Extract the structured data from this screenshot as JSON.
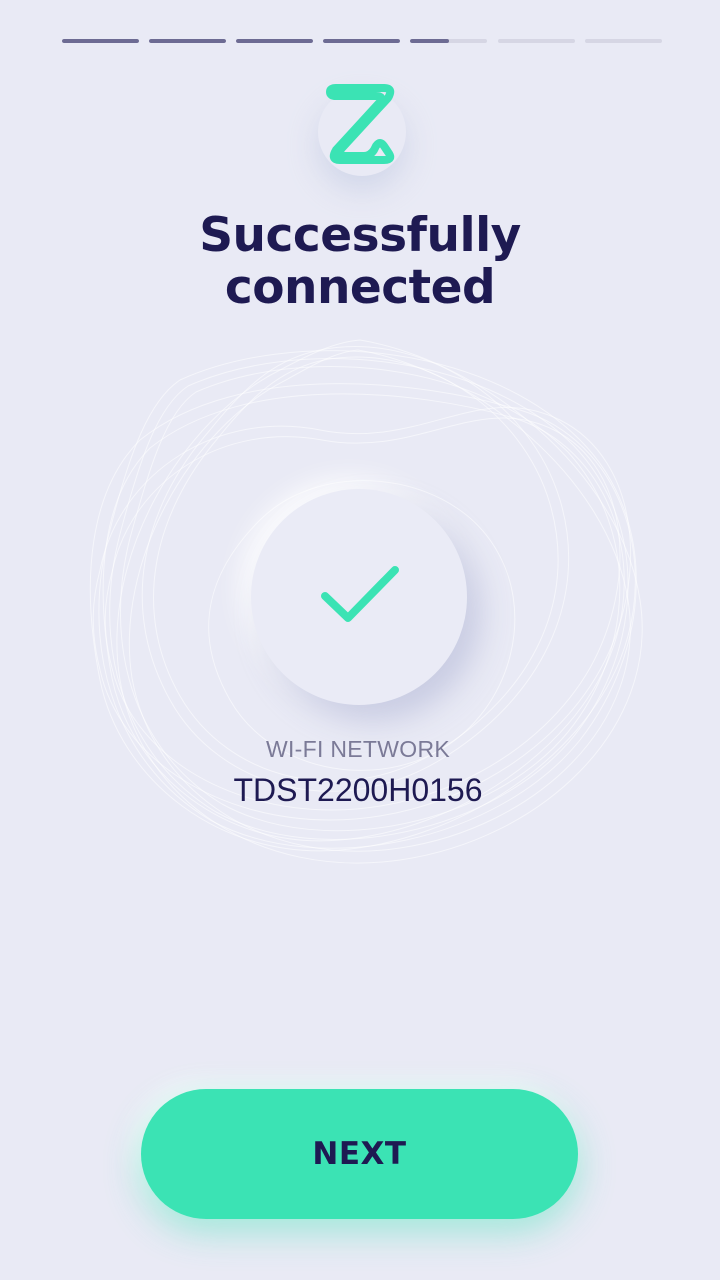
{
  "progress": {
    "total_steps": 7,
    "steps_complete": 4,
    "current_step_fraction": 0.5
  },
  "logo": {
    "icon": "z-logo-icon",
    "color": "#3be3b4"
  },
  "title": {
    "line1": "Successfully",
    "line2": "connected"
  },
  "status": {
    "icon": "checkmark-icon",
    "color": "#3be3b4"
  },
  "network": {
    "label": "WI-FI NETWORK",
    "name": "TDST2200H0156"
  },
  "next_button": {
    "label": "NEXT"
  },
  "colors": {
    "background": "#e9eaf5",
    "accent": "#3be3b4",
    "text_primary": "#1e1a52",
    "text_secondary": "#7b7a97"
  }
}
